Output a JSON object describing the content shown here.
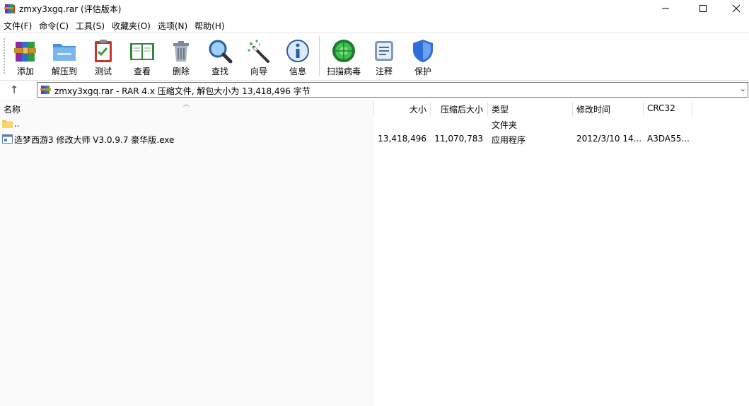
{
  "window": {
    "title": "zmxy3xgq.rar (评估版本)",
    "icon": "winrar-books-icon"
  },
  "menu": [
    "文件(F)",
    "命令(C)",
    "工具(S)",
    "收藏夹(O)",
    "选项(N)",
    "帮助(H)"
  ],
  "toolbar": {
    "buttons": [
      {
        "label": "添加",
        "icon": "add-archive-icon"
      },
      {
        "label": "解压到",
        "icon": "extract-folder-icon"
      },
      {
        "label": "测试",
        "icon": "test-clipboard-icon"
      },
      {
        "label": "查看",
        "icon": "view-book-icon"
      },
      {
        "label": "删除",
        "icon": "trash-icon"
      },
      {
        "label": "查找",
        "icon": "magnifier-icon"
      },
      {
        "label": "向导",
        "icon": "wizard-wand-icon"
      },
      {
        "label": "信息",
        "icon": "info-icon"
      },
      {
        "label": "扫描病毒",
        "icon": "virus-scan-icon"
      },
      {
        "label": "注释",
        "icon": "comment-icon"
      },
      {
        "label": "保护",
        "icon": "shield-icon"
      }
    ]
  },
  "address": {
    "text": "zmxy3xgq.rar - RAR 4.x 压缩文件, 解包大小为 13,418,496 字节"
  },
  "columns": {
    "name": "名称",
    "size": "大小",
    "packed": "压缩后大小",
    "type": "类型",
    "modified": "修改时间",
    "crc": "CRC32"
  },
  "rows": [
    {
      "name": "..",
      "size": "",
      "packed": "",
      "type": "文件夹",
      "modified": "",
      "crc": "",
      "icon": "folder-icon"
    },
    {
      "name": "造梦西游3 修改大师 V3.0.9.7 豪华版.exe",
      "size": "13,418,496",
      "packed": "11,070,783",
      "type": "应用程序",
      "modified": "2012/3/10 14...",
      "crc": "A3DA55...",
      "icon": "exe-icon"
    }
  ],
  "colors": {
    "folder": "#f5c542",
    "shield": "#2f6fdc",
    "virus": "#22a33a"
  }
}
